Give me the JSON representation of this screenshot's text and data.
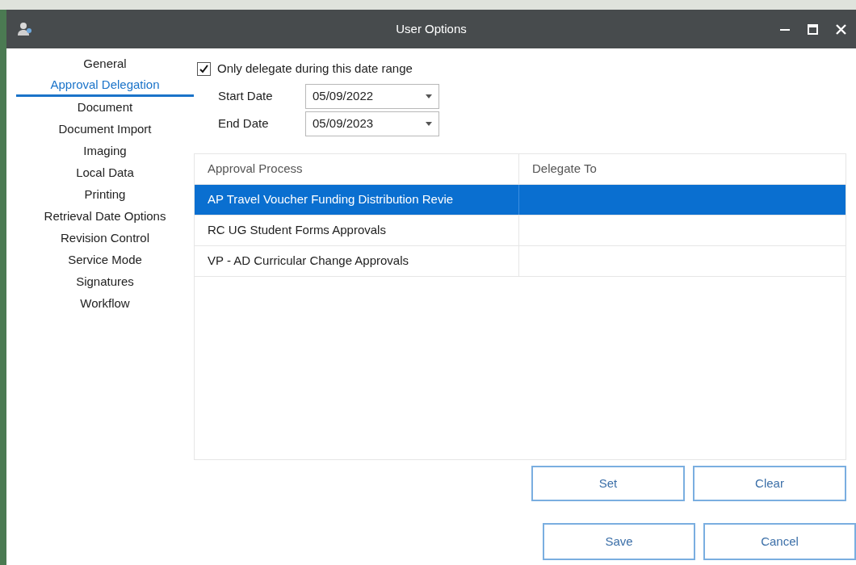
{
  "window": {
    "title": "User Options"
  },
  "sidebar": {
    "items": [
      {
        "label": "General",
        "selected": false
      },
      {
        "label": "Approval Delegation",
        "selected": true
      },
      {
        "label": "Document",
        "selected": false
      },
      {
        "label": "Document Import",
        "selected": false
      },
      {
        "label": "Imaging",
        "selected": false
      },
      {
        "label": "Local Data",
        "selected": false
      },
      {
        "label": "Printing",
        "selected": false
      },
      {
        "label": "Retrieval Date Options",
        "selected": false
      },
      {
        "label": "Revision Control",
        "selected": false
      },
      {
        "label": "Service Mode",
        "selected": false
      },
      {
        "label": "Signatures",
        "selected": false
      },
      {
        "label": "Workflow",
        "selected": false
      }
    ]
  },
  "date_range": {
    "label": "Only delegate during this date range",
    "checked": true
  },
  "start_date": {
    "label": "Start Date",
    "value": "05/09/2022"
  },
  "end_date": {
    "label": "End Date",
    "value": "05/09/2023"
  },
  "table": {
    "columns": [
      "Approval Process",
      "Delegate To"
    ],
    "rows": [
      {
        "approval_process": "AP Travel Voucher Funding Distribution Revie",
        "selected": true
      },
      {
        "approval_process": "RC UG Student Forms Approvals",
        "selected": false
      },
      {
        "approval_process": "VP - AD Curricular Change Approvals",
        "selected": false
      }
    ]
  },
  "table_buttons": [
    "Set",
    "Clear"
  ],
  "dialog_buttons": [
    "Save",
    "Cancel"
  ]
}
